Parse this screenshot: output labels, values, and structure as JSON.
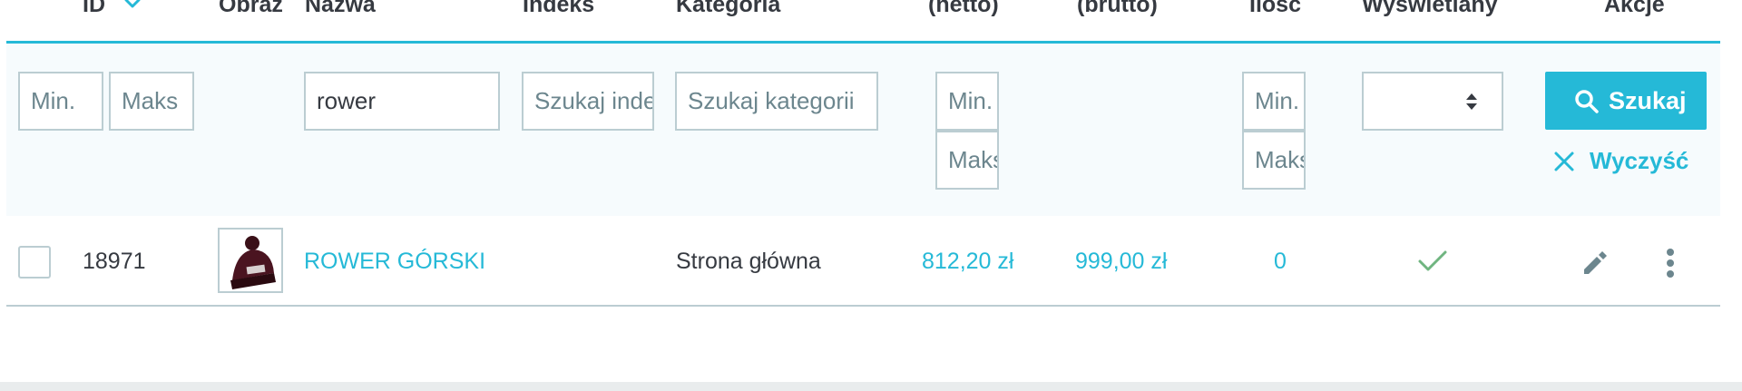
{
  "columns": {
    "id": "ID",
    "image": "Obraz",
    "name": "Nazwa",
    "reference": "Indeks",
    "category": "Kategoria",
    "price_net": "(netto)",
    "price_gross": "(brutto)",
    "quantity": "Ilość",
    "active": "Wyświetlany",
    "actions": "Akcje"
  },
  "filters": {
    "id_min": "Min.",
    "id_max": "Maks",
    "name_value": "rower",
    "reference_placeholder": "Szukaj indeksu",
    "category_placeholder": "Szukaj kategorii",
    "price_min": "Min.",
    "price_max": "Maks",
    "qty_min": "Min.",
    "qty_max": "Maks",
    "active_select": ""
  },
  "buttons": {
    "search": "Szukaj",
    "clear": "Wyczyść"
  },
  "products": [
    {
      "id": "18971",
      "name": "ROWER GÓRSKI",
      "reference": "",
      "category": "Strona główna",
      "price_net": "812,20 zł",
      "price_gross": "999,00 zł",
      "quantity": "0",
      "active": true
    }
  ],
  "colors": {
    "accent": "#25b9d7",
    "border": "#bbcdd2",
    "active_check": "#70b580"
  },
  "icons": {
    "sort": "chevron-down-icon",
    "search": "search-icon",
    "clear": "close-icon",
    "edit": "pencil-icon",
    "more": "more-vertical-icon"
  }
}
